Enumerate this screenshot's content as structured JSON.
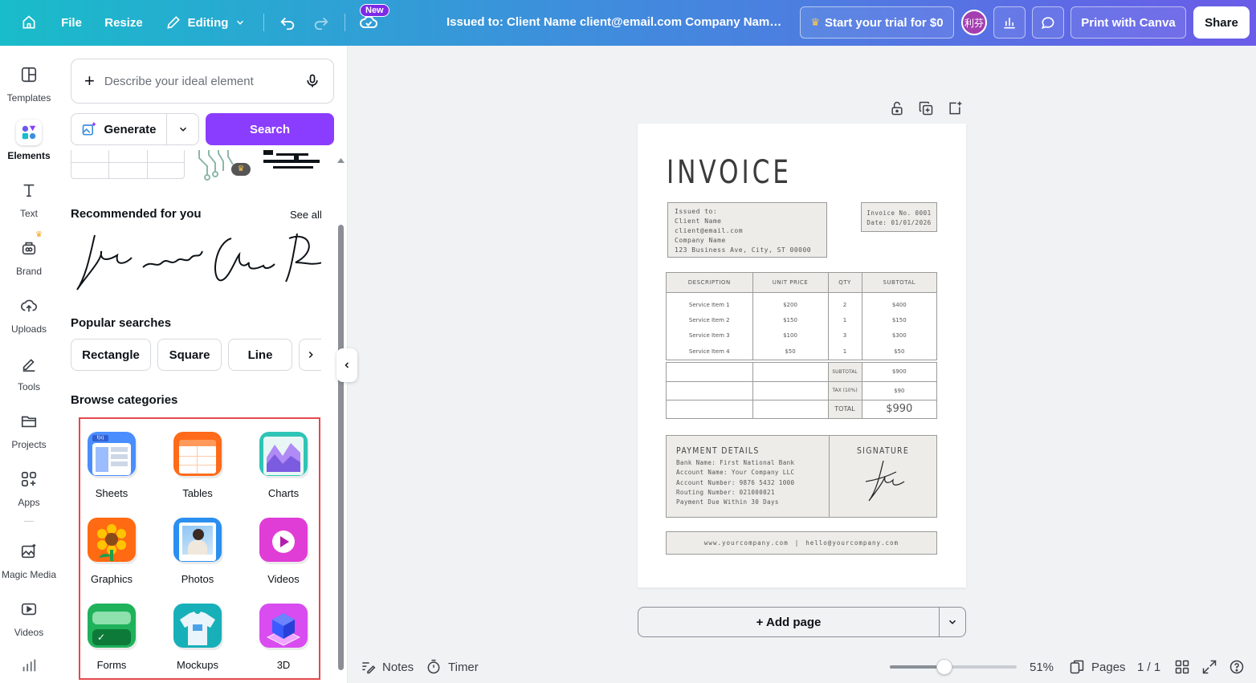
{
  "topbar": {
    "file_label": "File",
    "resize_label": "Resize",
    "editing_label": "Editing",
    "new_badge": "New",
    "doc_title": "Issued to: Client Name client@email.com Company Name 1...",
    "trial_label": "Start your trial for $0",
    "avatar_text": "利芬",
    "print_label": "Print with Canva",
    "share_label": "Share"
  },
  "rail": {
    "items": [
      {
        "label": "Templates"
      },
      {
        "label": "Elements"
      },
      {
        "label": "Text"
      },
      {
        "label": "Brand"
      },
      {
        "label": "Uploads"
      },
      {
        "label": "Tools"
      },
      {
        "label": "Projects"
      },
      {
        "label": "Apps"
      },
      {
        "label": "Magic Media"
      },
      {
        "label": "Videos"
      }
    ]
  },
  "panel": {
    "describe_placeholder": "Describe your ideal element",
    "generate_label": "Generate",
    "search_label": "Search",
    "recommended_title": "Recommended for you",
    "see_all": "See all",
    "popular_title": "Popular searches",
    "chips": [
      "Rectangle",
      "Square",
      "Line"
    ],
    "browse_title": "Browse categories",
    "categories": [
      {
        "label": "Sheets"
      },
      {
        "label": "Tables"
      },
      {
        "label": "Charts"
      },
      {
        "label": "Graphics"
      },
      {
        "label": "Photos"
      },
      {
        "label": "Videos"
      },
      {
        "label": "Forms"
      },
      {
        "label": "Mockups"
      },
      {
        "label": "3D"
      }
    ]
  },
  "invoice": {
    "title": "INVOICE",
    "issued": [
      "Issued to:",
      "Client Name",
      "client@email.com",
      "Company Name",
      "123 Business Ave, City, ST 00000"
    ],
    "invoice_no": "Invoice No. 0001",
    "invoice_date": "Date: 01/01/2026",
    "headers": [
      "DESCRIPTION",
      "UNIT PRICE",
      "QTY",
      "SUBTOTAL"
    ],
    "rows": [
      [
        "Service Item 1",
        "$200",
        "2",
        "$400"
      ],
      [
        "Service Item 2",
        "$150",
        "1",
        "$150"
      ],
      [
        "Service Item 3",
        "$100",
        "3",
        "$300"
      ],
      [
        "Service Item 4",
        "$50",
        "1",
        "$50"
      ]
    ],
    "summary": [
      {
        "label": "SUBTOTAL",
        "value": "$900"
      },
      {
        "label": "TAX (10%)",
        "value": "$90"
      },
      {
        "label": "TOTAL",
        "value": "$990"
      }
    ],
    "payment_title": "PAYMENT DETAILS",
    "payment_lines": [
      "Bank Name: First National Bank",
      "Account Name: Your Company LLC",
      "Account Number: 9876 5432 1000",
      "Routing Number: 021000021",
      "Payment Due Within 30 Days"
    ],
    "signature_title": "SIGNATURE",
    "footer_site": "www.yourcompany.com",
    "footer_sep": "|",
    "footer_email": "hello@yourcompany.com"
  },
  "canvas": {
    "add_page_label": "+ Add page"
  },
  "bottombar": {
    "notes_label": "Notes",
    "timer_label": "Timer",
    "zoom_value": "51%",
    "zoom_fraction": 0.43,
    "pages_label": "Pages",
    "page_count": "1 / 1"
  },
  "colors": {
    "accent_purple": "#8b3dff",
    "highlight_red": "#e5484d"
  }
}
